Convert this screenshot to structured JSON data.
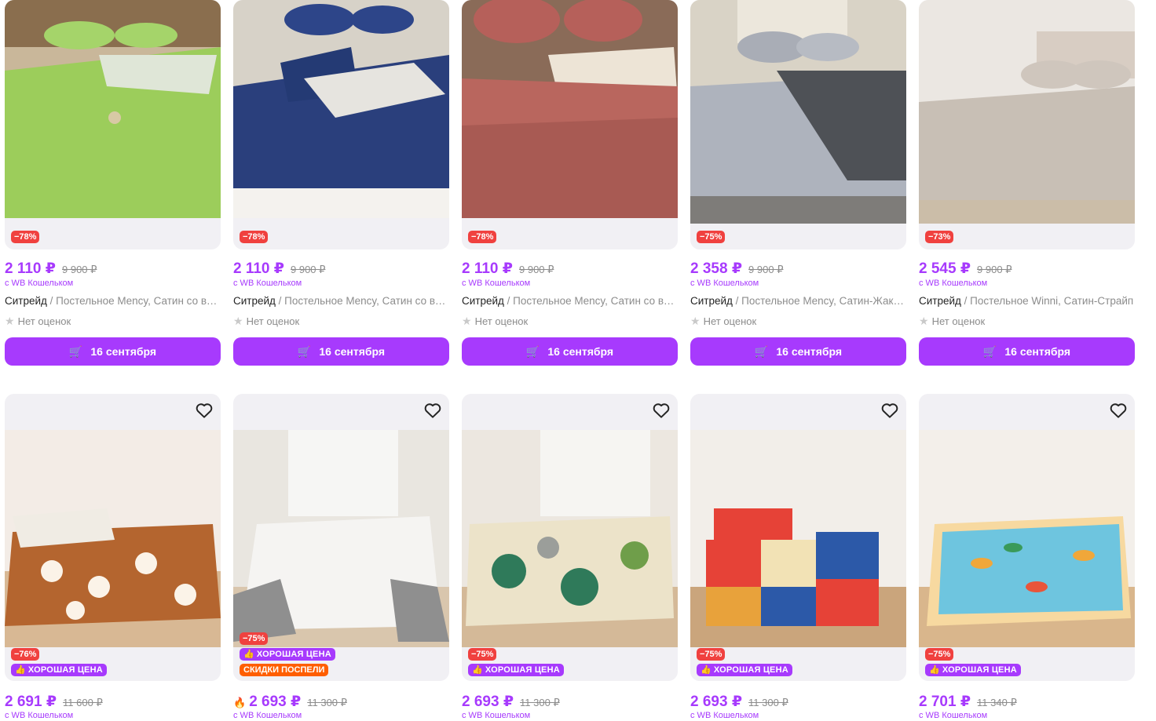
{
  "row1": [
    {
      "discount": "−78%",
      "price": "2 110 ₽",
      "old_price": "9 900 ₽",
      "wallet": "с WB Кошельком",
      "brand": "Ситрейд",
      "title": " / Постельное Mency, Сатин со вставкой",
      "rating": "Нет оценок",
      "delivery": "16 сентября"
    },
    {
      "discount": "−78%",
      "price": "2 110 ₽",
      "old_price": "9 900 ₽",
      "wallet": "с WB Кошельком",
      "brand": "Ситрейд",
      "title": " / Постельное Mency, Сатин со вставкой",
      "rating": "Нет оценок",
      "delivery": "16 сентября"
    },
    {
      "discount": "−78%",
      "price": "2 110 ₽",
      "old_price": "9 900 ₽",
      "wallet": "с WB Кошельком",
      "brand": "Ситрейд",
      "title": " / Постельное Mency, Сатин со вставкой",
      "rating": "Нет оценок",
      "delivery": "16 сентября"
    },
    {
      "discount": "−75%",
      "price": "2 358 ₽",
      "old_price": "9 900 ₽",
      "wallet": "с WB Кошельком",
      "brand": "Ситрейд",
      "title": " / Постельное Mency, Сатин-Жаккард",
      "rating": "Нет оценок",
      "delivery": "16 сентября"
    },
    {
      "discount": "−73%",
      "price": "2 545 ₽",
      "old_price": "9 900 ₽",
      "wallet": "с WB Кошельком",
      "brand": "Ситрейд",
      "title": " / Постельное Winni, Сатин-Страйп",
      "rating": "Нет оценок",
      "delivery": "16 сентября"
    }
  ],
  "row2": [
    {
      "discount": "−76%",
      "good_price": "ХОРОШАЯ ЦЕНА",
      "extra": "",
      "price": "2 691 ₽",
      "old_price": "11 600 ₽",
      "wallet": "с WB Кошельком"
    },
    {
      "discount": "−75%",
      "good_price": "ХОРОШАЯ ЦЕНА",
      "extra": "СКИДКИ ПОСПЕЛИ",
      "price": "2 693 ₽",
      "old_price": "11 300 ₽",
      "wallet": "с WB Кошельком"
    },
    {
      "discount": "−75%",
      "good_price": "ХОРОШАЯ ЦЕНА",
      "extra": "",
      "price": "2 693 ₽",
      "old_price": "11 300 ₽",
      "wallet": "с WB Кошельком"
    },
    {
      "discount": "−75%",
      "good_price": "ХОРОШАЯ ЦЕНА",
      "extra": "",
      "price": "2 693 ₽",
      "old_price": "11 300 ₽",
      "wallet": "с WB Кошельком"
    },
    {
      "discount": "−75%",
      "good_price": "ХОРОШАЯ ЦЕНА",
      "extra": "",
      "price": "2 701 ₽",
      "old_price": "11 340 ₽",
      "wallet": "с WB Кошельком"
    }
  ],
  "icons": {
    "favorite": "heart-outline-icon",
    "cart": "cart-icon",
    "star": "star-icon",
    "thumb": "thumbs-up-icon",
    "flame": "fire-icon"
  },
  "colors": {
    "accent": "#a73afd",
    "discount": "#f0413f",
    "promo": "#ff5e00",
    "card_bg": "#f1f0f4"
  }
}
